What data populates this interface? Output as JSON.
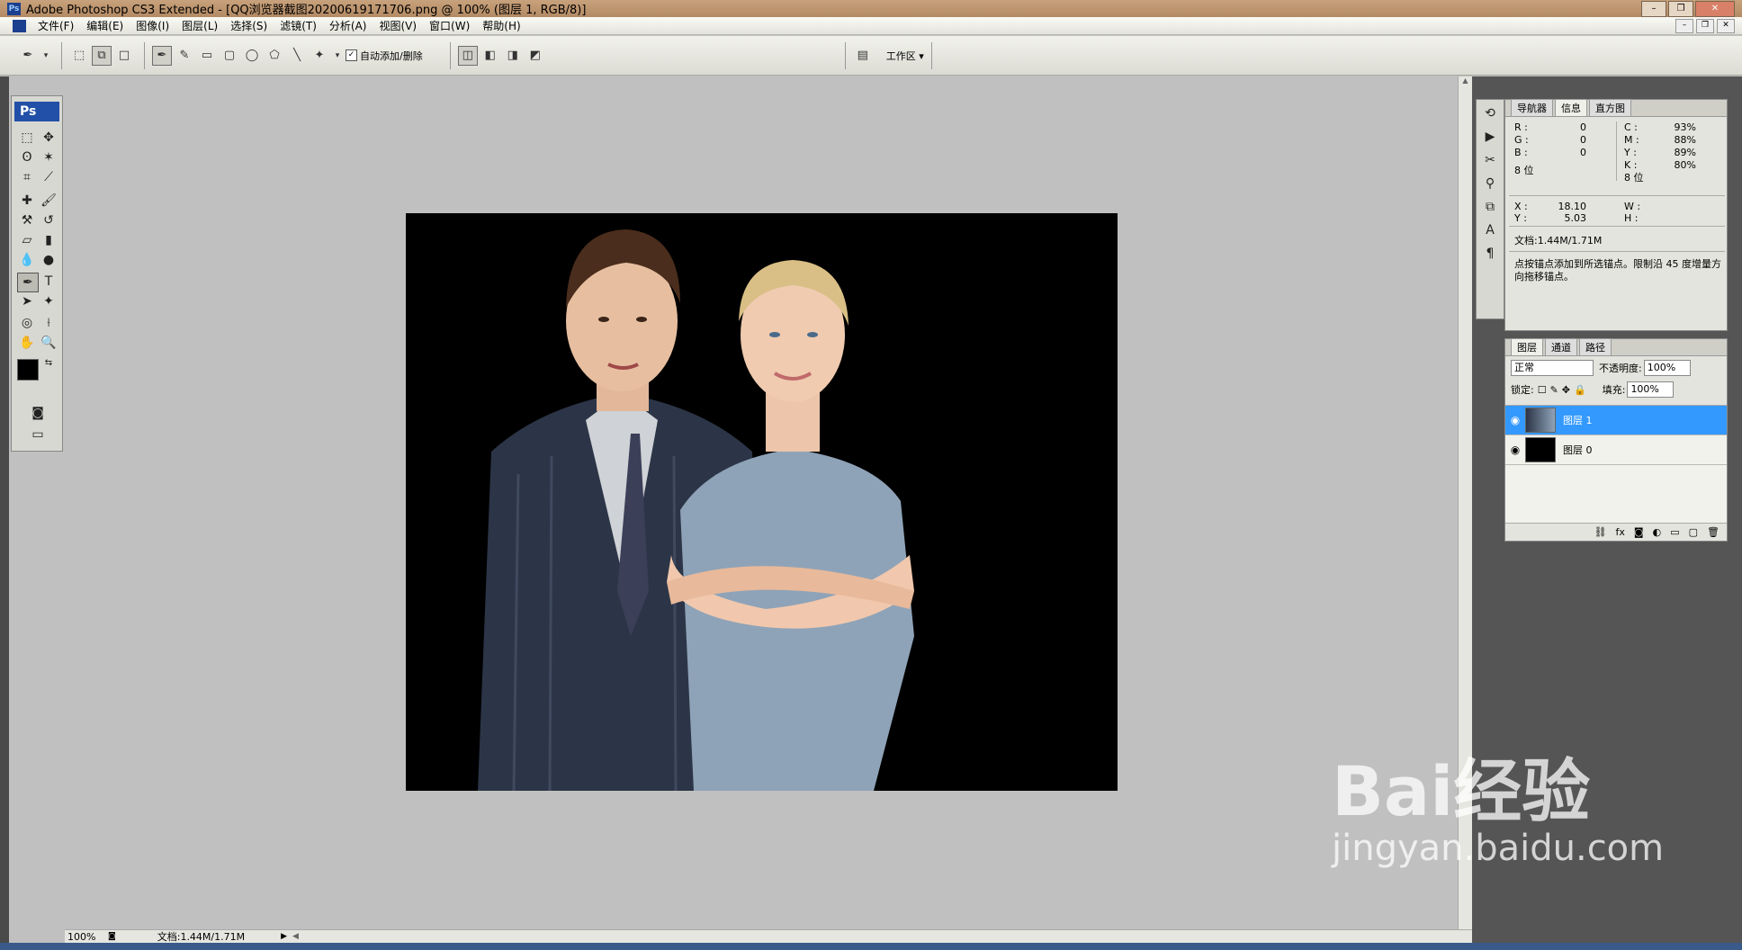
{
  "window": {
    "title": "Adobe Photoshop CS3 Extended - [QQ浏览器截图20200619171706.png @ 100% (图层 1, RGB/8)]",
    "app_icon": "Ps"
  },
  "menu": [
    "文件(F)",
    "编辑(E)",
    "图像(I)",
    "图层(L)",
    "选择(S)",
    "滤镜(T)",
    "分析(A)",
    "视图(V)",
    "窗口(W)",
    "帮助(H)"
  ],
  "options": {
    "auto_add_delete_label": "自动添加/删除",
    "workspace_label": "工作区 ▾"
  },
  "toolbox": {
    "logo": "Ps"
  },
  "status": {
    "zoom": "100%",
    "doc_size": "文档:1.44M/1.71M"
  },
  "info_panel": {
    "tabs": [
      "导航器",
      "信息",
      "直方图"
    ],
    "rgb": {
      "R": "0",
      "G": "0",
      "B": "0"
    },
    "cmyk": {
      "C": "93%",
      "M": "88%",
      "Y": "89%",
      "K": "80%"
    },
    "bit_left": "8 位",
    "bit_right": "8 位",
    "x": "18.10",
    "y": "5.03",
    "w_label": "W :",
    "h_label": "H :",
    "doc": "文档:1.44M/1.71M",
    "hint": "点按锚点添加到所选锚点。限制沿 45 度增量方向拖移锚点。"
  },
  "layers_panel": {
    "tabs": [
      "图层",
      "通道",
      "路径"
    ],
    "blend_mode": "正常",
    "opacity_label": "不透明度:",
    "opacity": "100%",
    "lock_label": "锁定:",
    "fill_label": "填充:",
    "fill": "100%",
    "layers": [
      {
        "name": "图层 1",
        "selected": true
      },
      {
        "name": "图层 0",
        "selected": false
      }
    ]
  },
  "watermark": {
    "brand": "Bai经验",
    "url": "jingyan.baidu.com"
  },
  "colors": {
    "selection": "#3399ff",
    "ps_blue": "#2250a8"
  }
}
